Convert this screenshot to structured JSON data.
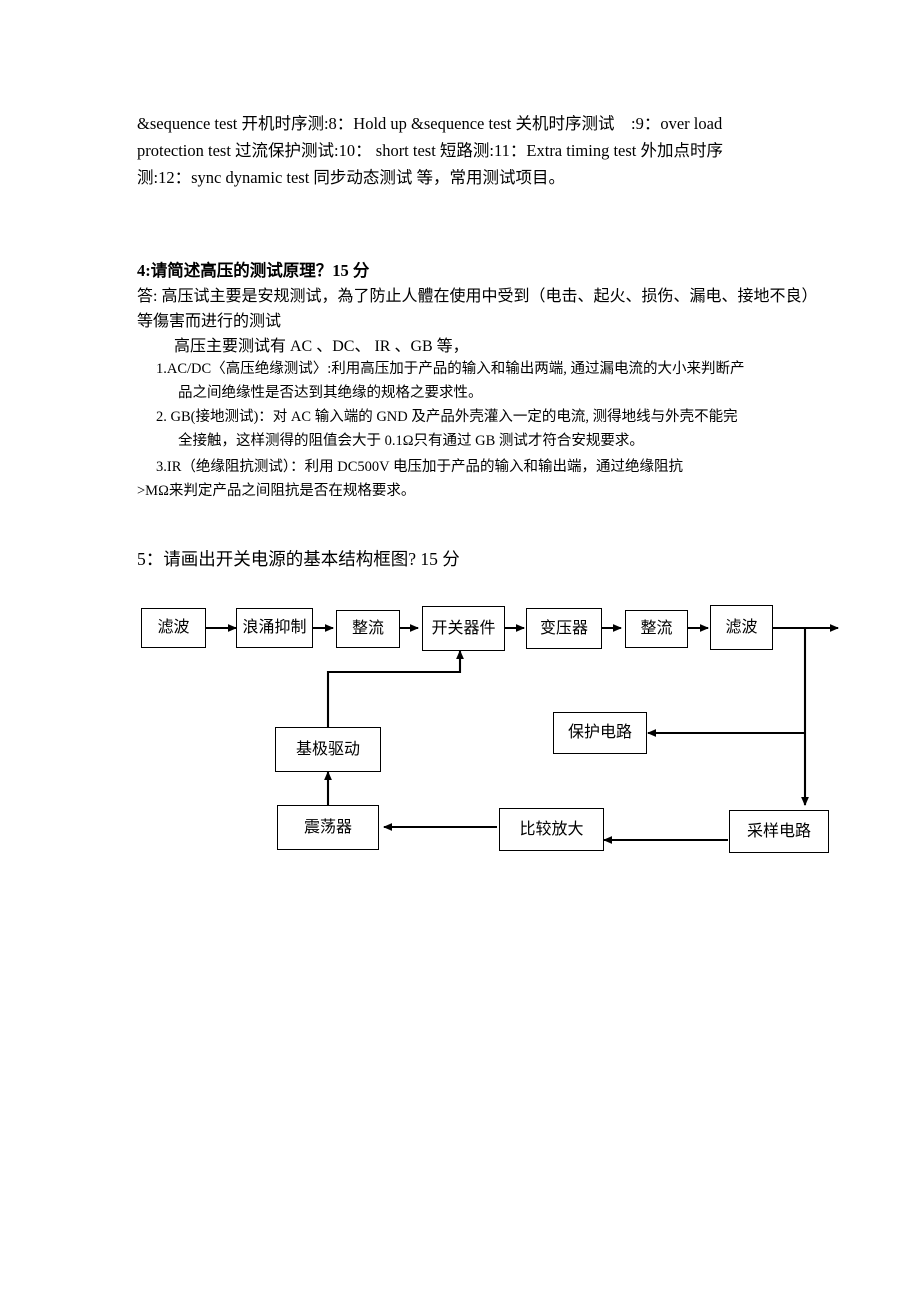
{
  "document": {
    "paragraphs": {
      "p1_line1": "&sequence test 开机时序测:8：Hold up &sequence test 关机时序测试　:9：over load",
      "p1_line2": "protection test  过流保护测试:10：  short test 短路测:11：Extra timing test   外加点时序",
      "p1_line3": "测:12：sync dynamic test 同步动态测试 等，常用测试项目。"
    },
    "question4": {
      "heading": "4:请简述高压的测试原理？15 分",
      "answer_line1": "答: 高压试主要是安规测试，為了防止人體在使用中受到（电击、起火、损伤、漏电、接地不良）",
      "answer_line2": "等傷害而进行的测试",
      "answer_line3": "高压主要测试有 AC 、DC、 IR 、GB 等，",
      "item1_line1": "1.AC/DC〈高压绝缘测试〉:利用高压加于产品的输入和输出两端, 通过漏电流的大小来判断产",
      "item1_line2": "品之间绝缘性是否达到其绝缘的规格之要求性。",
      "item2_line1": "2.   GB(接地测试)：对 AC 输入端的 GND 及产品外壳灌入一定的电流, 测得地线与外壳不能完",
      "item2_line2": "全接触，这样测得的阻值会大于 0.1Ω只有通过 GB 测试才符合安规要求。",
      "item3_line1": "3.IR（绝缘阻抗测试）：利用 DC500V 电压加于产品的输入和输出端，通过绝缘阻抗",
      "item3_line2": ">MΩ来判定产品之间阻抗是否在规格要求。"
    },
    "question5": {
      "heading": "5：请画出开关电源的基本结构框图?   15 分"
    }
  },
  "diagram": {
    "nodes": {
      "filter_in": "滤波",
      "surge_suppress": "浪涌抑制",
      "rectifier_1": "整流",
      "switch_device": "开关器件",
      "transformer": "变压器",
      "rectifier_2": "整流",
      "filter_out": "滤波",
      "base_drive": "基极驱动",
      "protection_circuit": "保护电路",
      "oscillator": "震荡器",
      "comparator_amp": "比较放大",
      "sampling_circuit": "采样电路"
    }
  }
}
